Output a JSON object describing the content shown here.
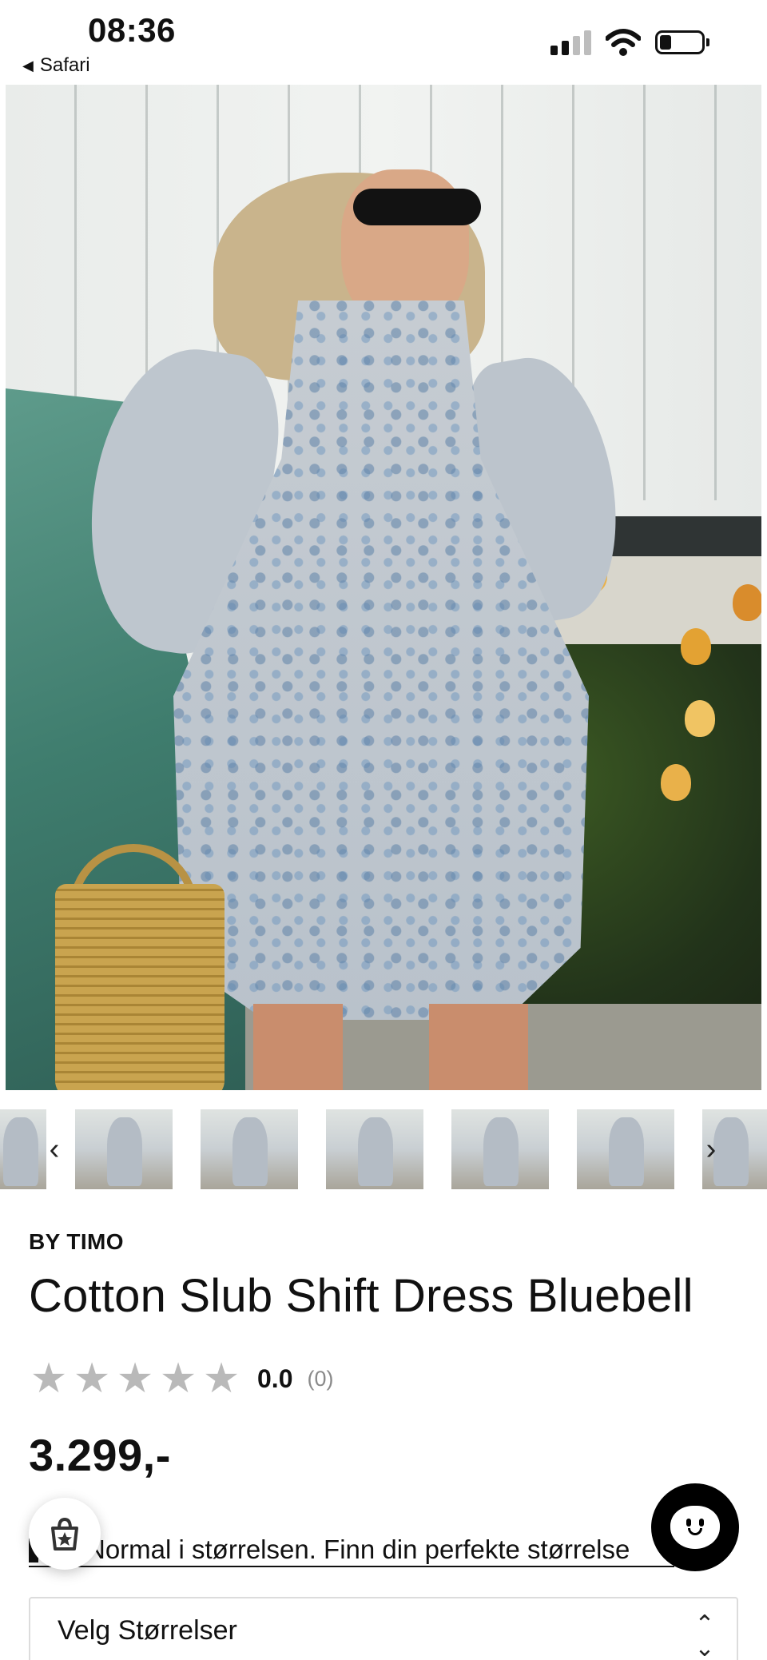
{
  "status_bar": {
    "time": "08:36",
    "back_app": "Safari"
  },
  "product": {
    "brand": "BY TIMO",
    "title": "Cotton Slub Shift Dress Bluebell",
    "rating_value": "0.0",
    "rating_count": "(0)",
    "stars_filled": 0,
    "stars_total": 5,
    "price": "3.299,-",
    "fit_note": "Normal i størrelsen. Finn din perfekte størrelse",
    "size_select_placeholder": "Velg Størrelser"
  },
  "gallery": {
    "prev_arrow": "‹",
    "next_arrow": "›",
    "thumbnail_count": 6
  },
  "colors": {
    "text": "#111111",
    "star_empty": "#b9b9b9",
    "muted": "#8a8a8a",
    "chat_button": "#000000"
  },
  "icons": {
    "back": "triangle-left-icon",
    "signal": "cellular-signal-icon",
    "wifi": "wifi-icon",
    "battery": "battery-icon",
    "loyalty": "shopping-bag-star-icon",
    "chat": "chat-smiley-icon",
    "select": "chevron-up-down-icon"
  }
}
